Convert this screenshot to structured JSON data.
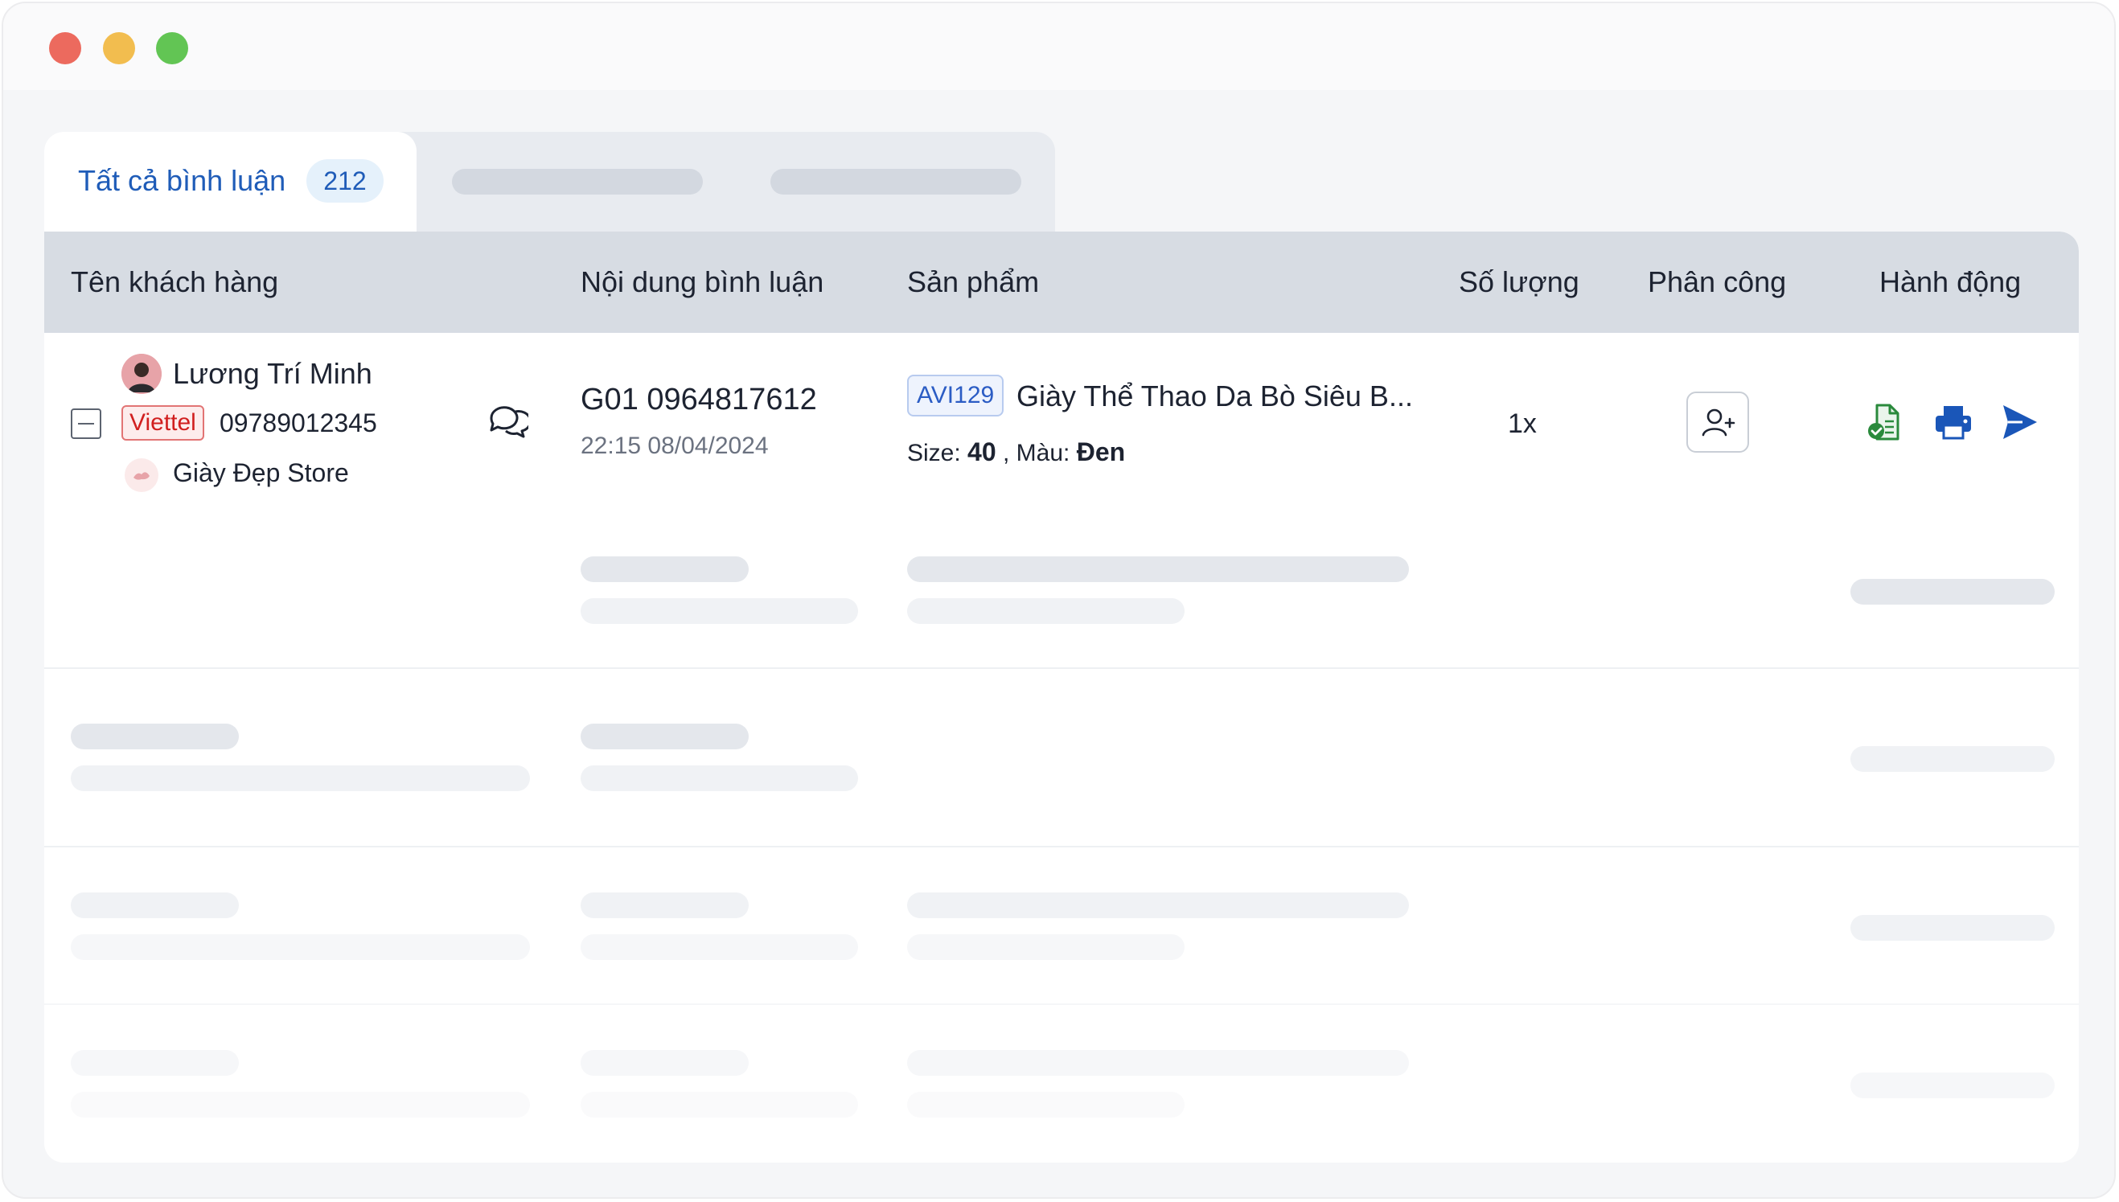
{
  "tabs": {
    "active_label": "Tất cả bình luận",
    "active_count": "212"
  },
  "table": {
    "headers": [
      "Tên khách hàng",
      "Nội dung bình luận",
      "Sản phẩm",
      "Số lượng",
      "Phân công",
      "Hành động"
    ],
    "row": {
      "customer_name": "Lương Trí Minh",
      "carrier": "Viettel",
      "phone": "09789012345",
      "store": "Giày Đẹp Store",
      "comment": "G01 0964817612",
      "comment_time": "22:15 08/04/2024",
      "sku": "AVI129",
      "product": "Giày Thể Thao Da Bò Siêu B...",
      "size_label": "Size:",
      "size_value": "40",
      "color_label": ", Màu:",
      "color_value": "Đen",
      "quantity": "1x"
    }
  },
  "icons": {
    "chat": "chat-bubbles-icon",
    "assign": "user-plus-icon",
    "actions": [
      "document-check-icon",
      "printer-icon",
      "send-icon"
    ]
  },
  "colors": {
    "accent": "#1f5cb8",
    "header_bg": "#d7dce3",
    "carrier_red": "#d11f1f",
    "doc_green": "#2a8a3c",
    "print_blue": "#1a56b8"
  }
}
